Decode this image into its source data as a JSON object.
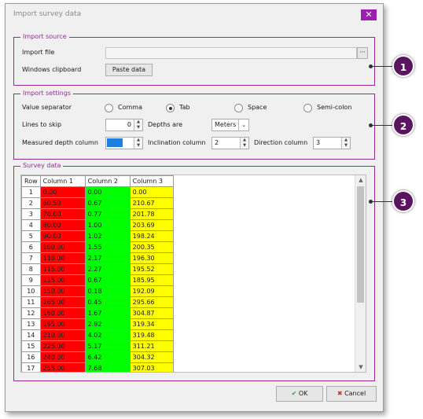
{
  "window": {
    "title": "Import survey data",
    "close_label": "✕"
  },
  "import_source": {
    "legend": "Import source",
    "import_file_label": "Import file",
    "import_file_value": "",
    "browse_label": "···",
    "clipboard_label": "Windows clipboard",
    "paste_label": "Paste data"
  },
  "import_settings": {
    "legend": "Import settings",
    "value_separator_label": "Value separator",
    "separators": [
      "Comma",
      "Tab",
      "Space",
      "Semi-colon"
    ],
    "selected_separator": "Tab",
    "lines_to_skip_label": "Lines to skip",
    "lines_to_skip_value": "0",
    "depths_are_label": "Depths are",
    "depths_are_value": "Meters",
    "measured_depth_label": "Measured depth column",
    "measured_depth_value": "1",
    "inclination_label": "Inclination column",
    "inclination_value": "2",
    "direction_label": "Direction column",
    "direction_value": "3"
  },
  "survey_data": {
    "legend": "Survey data",
    "headers": [
      "Row",
      "Column 1",
      "Column 2",
      "Column 3"
    ],
    "rows": [
      [
        "1",
        "0.00",
        "0.00",
        "0.00"
      ],
      [
        "2",
        "60.50",
        "0.67",
        "210.67"
      ],
      [
        "3",
        "70.00",
        "0.77",
        "201.78"
      ],
      [
        "4",
        "80.00",
        "1.00",
        "203.69"
      ],
      [
        "5",
        "90.00",
        "1.02",
        "198.24"
      ],
      [
        "6",
        "100.00",
        "1.55",
        "200.35"
      ],
      [
        "7",
        "110.00",
        "2.17",
        "196.30"
      ],
      [
        "8",
        "115.00",
        "2.27",
        "195.52"
      ],
      [
        "9",
        "135.00",
        "0.67",
        "185.95"
      ],
      [
        "10",
        "150.00",
        "0.18",
        "192.09"
      ],
      [
        "11",
        "165.00",
        "0.45",
        "295.66"
      ],
      [
        "12",
        "180.00",
        "1.67",
        "304.87"
      ],
      [
        "13",
        "195.00",
        "2.92",
        "319.34"
      ],
      [
        "14",
        "210.00",
        "4.02",
        "319.48"
      ],
      [
        "15",
        "225.00",
        "5.17",
        "311.21"
      ],
      [
        "16",
        "240.00",
        "6.42",
        "304.32"
      ],
      [
        "17",
        "255.00",
        "7.68",
        "307.03"
      ]
    ]
  },
  "footer": {
    "ok_label": "OK",
    "cancel_label": "Cancel"
  },
  "callouts": [
    "1",
    "2",
    "3"
  ],
  "colors": {
    "accent": "#8e2f8e",
    "callout": "#5b1560",
    "col1": "#ff0000",
    "col2": "#00ff00",
    "col3": "#ffff00"
  }
}
